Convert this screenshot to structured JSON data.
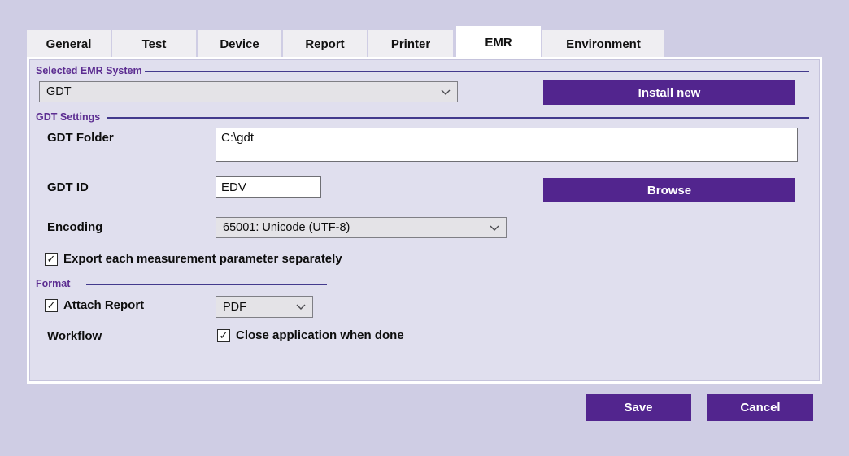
{
  "tabs": [
    {
      "label": "General",
      "active": false
    },
    {
      "label": "Test",
      "active": false
    },
    {
      "label": "Device",
      "active": false
    },
    {
      "label": "Report",
      "active": false
    },
    {
      "label": "Printer",
      "active": false
    },
    {
      "label": "EMR",
      "active": true
    },
    {
      "label": "Environment",
      "active": false
    }
  ],
  "emr_system": {
    "group_title": "Selected EMR System",
    "selected_value": "GDT",
    "install_button": "Install new"
  },
  "gdt_settings": {
    "group_title": "GDT Settings",
    "folder_label": "GDT Folder",
    "folder_value": "C:\\gdt",
    "id_label": "GDT ID",
    "id_value": "EDV",
    "browse_button": "Browse",
    "encoding_label": "Encoding",
    "encoding_value": "65001: Unicode (UTF-8)",
    "export_checkbox_label": "Export each measurement parameter separately",
    "export_checkbox_checked": "✓"
  },
  "format": {
    "group_title": "Format",
    "attach_checkbox_label": "Attach Report",
    "attach_checkbox_checked": "✓",
    "format_value": "PDF",
    "workflow_label": "Workflow",
    "close_checkbox_label": "Close application when done",
    "close_checkbox_checked": "✓"
  },
  "footer": {
    "save_button": "Save",
    "cancel_button": "Cancel"
  },
  "colors": {
    "accent_purple": "#52258e",
    "group_header_purple": "#5c2d91",
    "group_line_indigo": "#433a8d",
    "window_bg": "#cfcde4",
    "panel_bg": "#e0dfee",
    "tab_inactive_bg": "#efeef2",
    "tab_active_bg": "#ffffff"
  }
}
